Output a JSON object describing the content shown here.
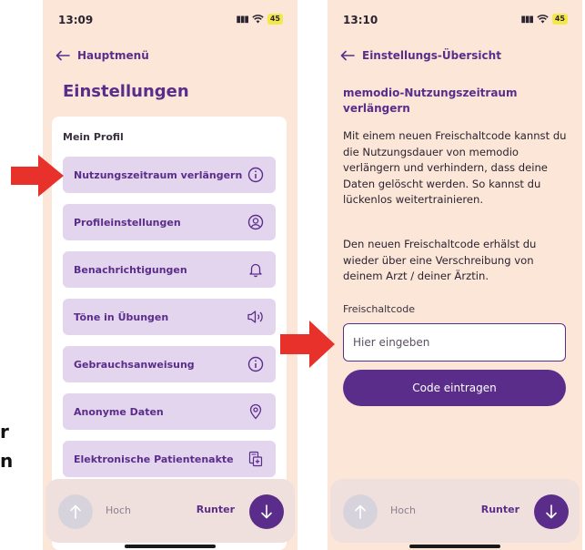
{
  "left_screen": {
    "status_time": "13:09",
    "battery": "45",
    "back_label": "Hauptmenü",
    "title": "Einstellungen",
    "section_heading": "Mein Profil",
    "menu_items": [
      {
        "label": "Nutzungszeitraum verlängern",
        "icon": "info-icon"
      },
      {
        "label": "Profileinstellungen",
        "icon": "user-circle-icon"
      },
      {
        "label": "Benachrichtigungen",
        "icon": "bell-icon"
      },
      {
        "label": "Töne in Übungen",
        "icon": "speaker-icon"
      },
      {
        "label": "Gebrauchsanweisung",
        "icon": "info-icon"
      },
      {
        "label": "Anonyme Daten",
        "icon": "location-pin-icon"
      },
      {
        "label": "Elektronische Patientenakte",
        "icon": "health-record-icon"
      }
    ],
    "nav": {
      "up_label": "Hoch",
      "down_label": "Runter"
    }
  },
  "right_screen": {
    "status_time": "13:10",
    "battery": "45",
    "back_label": "Einstellungs-Übersicht",
    "section_title": "memodio-Nutzungszeitraum verlängern",
    "paragraph_1": "Mit einem neuen Freischaltcode kannst du die Nutzungsdauer von memodio verlängern und verhindern, dass deine Daten gelöscht werden. So kannst du lückenlos weitertrainieren.",
    "paragraph_2": "Den neuen Freischaltcode erhälst du wieder über eine Verschreibung von deinem Arzt / deiner Ärztin.",
    "field_label": "Freischaltcode",
    "input_placeholder": "Hier eingeben",
    "submit_label": "Code eintragen",
    "nav": {
      "up_label": "Hoch",
      "down_label": "Runter"
    }
  },
  "side_fragments": [
    "r",
    "n"
  ],
  "colors": {
    "accent": "#5a2d8a",
    "background": "#fbe6d8",
    "menu_item_bg": "#e4d5ee",
    "highlight_arrow": "#e8312a",
    "battery": "#f3e84a"
  }
}
